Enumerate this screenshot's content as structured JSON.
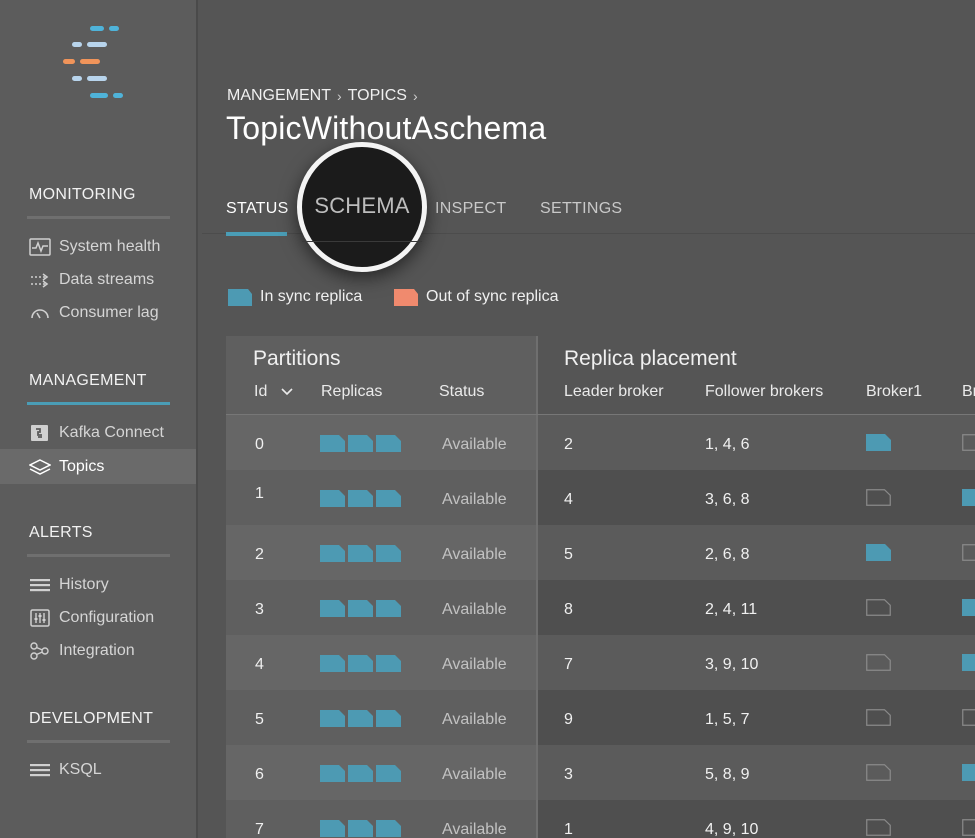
{
  "app": {
    "colors": {
      "accent": "#4a9db6",
      "in_sync": "#4d9ab3",
      "out_of_sync": "#f08a6e",
      "logo_orange": "#f0945a",
      "logo_blue": "#4fb3d9",
      "logo_light": "#b8d4ec"
    }
  },
  "sidebar": {
    "sections": [
      {
        "title": "MONITORING",
        "items": [
          {
            "label": "System health",
            "icon": "heartbeat-icon"
          },
          {
            "label": "Data streams",
            "icon": "data-streams-icon"
          },
          {
            "label": "Consumer lag",
            "icon": "gauge-icon"
          }
        ]
      },
      {
        "title": "MANAGEMENT",
        "items": [
          {
            "label": "Kafka Connect",
            "icon": "connector-icon"
          },
          {
            "label": "Topics",
            "icon": "layers-icon",
            "active": true
          }
        ]
      },
      {
        "title": "ALERTS",
        "items": [
          {
            "label": "History",
            "icon": "list-icon"
          },
          {
            "label": "Configuration",
            "icon": "sliders-icon"
          },
          {
            "label": "Integration",
            "icon": "integration-icon"
          }
        ]
      },
      {
        "title": "DEVELOPMENT",
        "items": [
          {
            "label": "KSQL",
            "icon": "list-icon"
          }
        ]
      }
    ]
  },
  "header": {
    "breadcrumb": [
      "MANGEMENT",
      "TOPICS"
    ],
    "title": "TopicWithoutAschema"
  },
  "tabs": [
    {
      "label": "STATUS",
      "active": true
    },
    {
      "label": "SCHEMA",
      "magnified": true
    },
    {
      "label": "INSPECT"
    },
    {
      "label": "SETTINGS"
    }
  ],
  "legend": [
    {
      "label": "In sync replica",
      "color": "#4d9ab3"
    },
    {
      "label": "Out of sync replica",
      "color": "#f08a6e"
    }
  ],
  "table": {
    "partitions_title": "Partitions",
    "placement_title": "Replica placement",
    "columns": {
      "id": "Id",
      "replicas": "Replicas",
      "status": "Status",
      "leader": "Leader broker",
      "followers": "Follower brokers",
      "broker1": "Broker1",
      "broker2": "Br"
    },
    "rows": [
      {
        "id": "0",
        "status": "Available",
        "leader": "2",
        "followers": "1, 4, 6",
        "broker1": "in",
        "broker2": "empty"
      },
      {
        "id": "1",
        "status": "Available",
        "leader": "4",
        "followers": "3, 6, 8",
        "broker1": "empty",
        "broker2": "in"
      },
      {
        "id": "2",
        "status": "Available",
        "leader": "5",
        "followers": "2, 6, 8",
        "broker1": "in",
        "broker2": "empty"
      },
      {
        "id": "3",
        "status": "Available",
        "leader": "8",
        "followers": "2, 4, 11",
        "broker1": "empty",
        "broker2": "in"
      },
      {
        "id": "4",
        "status": "Available",
        "leader": "7",
        "followers": "3, 9, 10",
        "broker1": "empty",
        "broker2": "in"
      },
      {
        "id": "5",
        "status": "Available",
        "leader": "9",
        "followers": "1, 5, 7",
        "broker1": "empty",
        "broker2": "empty"
      },
      {
        "id": "6",
        "status": "Available",
        "leader": "3",
        "followers": "5, 8, 9",
        "broker1": "empty",
        "broker2": "in"
      },
      {
        "id": "7",
        "status": "Available",
        "leader": "1",
        "followers": "4, 9, 10",
        "broker1": "empty",
        "broker2": "empty"
      }
    ]
  }
}
